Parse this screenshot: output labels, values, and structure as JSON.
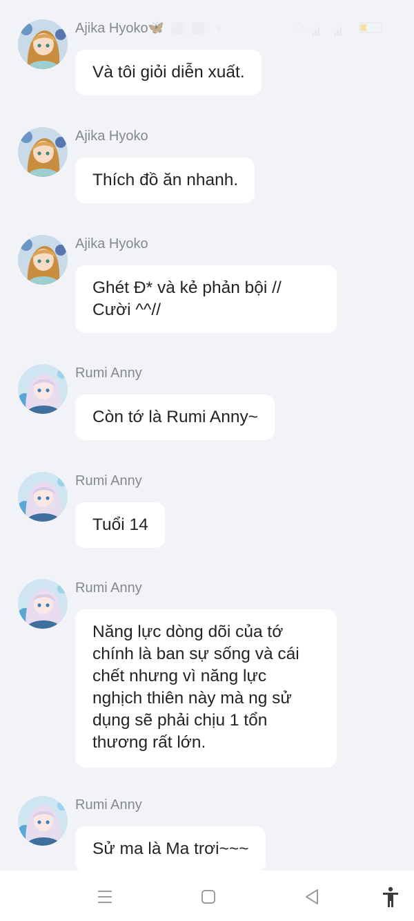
{
  "status_bar": {
    "time": "20:07"
  },
  "messages": [
    {
      "sender": "Ajika Hyoko",
      "avatar": "avatar-ajika",
      "text": "Và tôi giỏi diễn xuất."
    },
    {
      "sender": "Ajika Hyoko",
      "avatar": "avatar-ajika",
      "text": "Thích đồ ăn nhanh."
    },
    {
      "sender": "Ajika Hyoko",
      "avatar": "avatar-ajika",
      "text": "Ghét Đ* và kẻ phản bội // Cười ^^//"
    },
    {
      "sender": "Rumi Anny",
      "avatar": "avatar-rumi",
      "text": "Còn tớ là Rumi Anny~"
    },
    {
      "sender": "Rumi Anny",
      "avatar": "avatar-rumi",
      "text": "Tuổi 14"
    },
    {
      "sender": "Rumi Anny",
      "avatar": "avatar-rumi",
      "text": "Năng lực dòng dõi của tớ chính là ban sự sống và cái chết nhưng vì năng lực nghịch thiên này mà ng sử dụng sẽ phải chịu 1 tổn thương rất lớn."
    },
    {
      "sender": "Rumi Anny",
      "avatar": "avatar-rumi",
      "text": "Sử ma là Ma trơi~~~"
    }
  ],
  "nav_bar": {
    "icons": [
      "menu-icon",
      "home-square-icon",
      "back-triangle-icon",
      "accessibility-icon"
    ]
  },
  "colors": {
    "background": "#f2f3f7",
    "bubble": "#ffffff",
    "sender_text": "#858891",
    "message_text": "#222325"
  }
}
